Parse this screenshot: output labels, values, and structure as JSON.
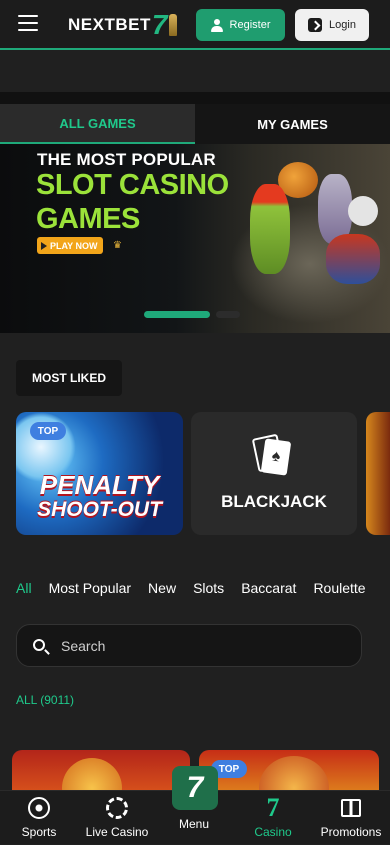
{
  "header": {
    "logo_text": "NEXTBET",
    "logo_seven": "7",
    "register_label": "Register",
    "login_label": "Login"
  },
  "tabs": [
    {
      "label": "ALL GAMES",
      "active": true
    },
    {
      "label": "MY GAMES",
      "active": false
    }
  ],
  "banner": {
    "line1": "THE MOST POPULAR",
    "line2": "SLOT CASINO",
    "line3": "GAMES",
    "cta": "PLAY NOW"
  },
  "most_liked": {
    "label": "MOST LIKED",
    "cards": [
      {
        "badge": "TOP",
        "title_line1": "PENALTY",
        "title_line2": "SHOOT-OUT"
      },
      {
        "title": "BLACKJACK"
      }
    ]
  },
  "filters": [
    "All",
    "Most Popular",
    "New",
    "Slots",
    "Baccarat",
    "Roulette"
  ],
  "search": {
    "placeholder": "Search"
  },
  "all_count": "ALL (9011)",
  "bottom_cards": [
    {
      "badge": ""
    },
    {
      "badge": "TOP"
    }
  ],
  "nav": {
    "sports": "Sports",
    "live_casino": "Live Casino",
    "menu": "Menu",
    "menu_tile": "7",
    "casino": "Casino",
    "casino_glyph": "7",
    "promotions": "Promotions"
  },
  "colors": {
    "accent": "#1fa97a",
    "accent_text": "#1fc98b",
    "badge": "#3f7fe0"
  }
}
